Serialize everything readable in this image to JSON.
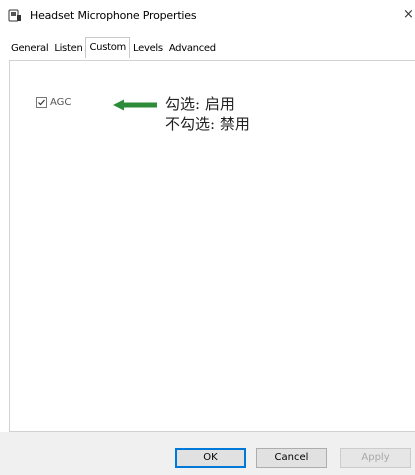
{
  "window": {
    "title": "Headset Microphone Properties",
    "close_glyph": "×"
  },
  "tabs": [
    {
      "label": "General",
      "active": false
    },
    {
      "label": "Listen",
      "active": false
    },
    {
      "label": "Custom",
      "active": true
    },
    {
      "label": "Levels",
      "active": false
    },
    {
      "label": "Advanced",
      "active": false
    }
  ],
  "custom": {
    "agc": {
      "label": "AGC",
      "checked": true
    },
    "annotation": {
      "line1": "勾选: 启用",
      "line2": "不勾选: 禁用",
      "arrow_color": "#2e8b3a"
    }
  },
  "footer": {
    "ok_label": "OK",
    "cancel_label": "Cancel",
    "apply_label": "Apply"
  },
  "icons": {
    "title": "microphone-icon",
    "close": "close-icon",
    "checkbox": "checkmark-icon",
    "annotation": "arrow-left-icon"
  }
}
